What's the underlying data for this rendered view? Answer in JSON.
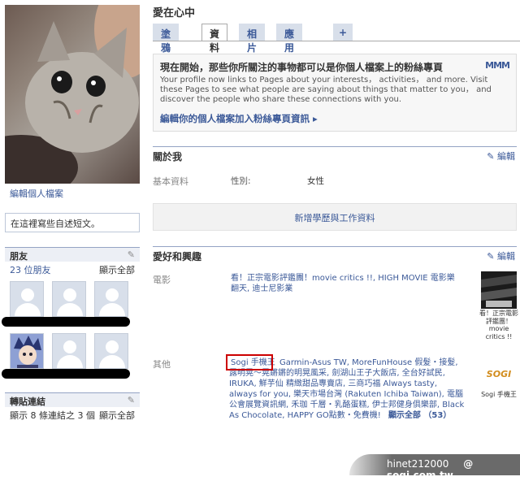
{
  "left": {
    "edit_profile": "編輯個人檔案",
    "status_placeholder": "在這裡寫些自述短文。",
    "friends": {
      "title": "朋友",
      "count": "23 位朋友",
      "show_all": "顯示全部"
    },
    "links": {
      "title": "轉貼連結",
      "summary": "顯示 8 條連結之 3 個",
      "show_all": "顯示全部"
    }
  },
  "header": {
    "name": "愛在心中",
    "tabs": [
      "塗鴉牆",
      "資料",
      "相片",
      "應用程式",
      "+"
    ]
  },
  "promo": {
    "title": "現在開始，那些你所關注的事物都可以是你個人檔案上的粉絲專頁",
    "text": "Your profile now links to Pages about your interests， activities， and more. Visit these Pages to see what people are saying about things that matter to you， and discover the people who share these connections with you.",
    "link": "編輯你的個人檔案加入粉絲專頁資訊 ▸",
    "icon": "MMM"
  },
  "about": {
    "title": "關於我",
    "edit": "編輯",
    "basic_label": "基本資料",
    "gender_label": "性別:",
    "gender_value": "女性",
    "add_edu": "新增學歷與工作資料"
  },
  "interests": {
    "title": "愛好和興趣",
    "edit": "編輯",
    "movies_label": "電影",
    "movies_text": "看！正宗電影評鑑團！movie critics !!, HIGH MOVIE 電影樂翻天, 迪士尼影業",
    "movies_thumb_caption": "看！正宗電影評鑑團！movie critics !!",
    "other_label": "其他",
    "other_first": "Sogi 手機王",
    "other_text": "Garmin-Asus TW, MoreFunHouse 假髮・接髮, 露明晃～晃鏘鏘的明晃風采, 劍湖山王子大飯店, 全台好試民, IRUKA, 鮮芋仙 精緻甜品專賣店, 三商巧福 Always tasty, always for you, 樂天市場台灣 (Rakuten Ichiba Taiwan), 電腦公會展覽資訊網, 禾珈 千層・乳酪蛋糕, 伊士邦健身俱樂部, Black As Chocolate, HAPPY GO點數・免費機!",
    "show_all": "顯示全部 （53）",
    "other_thumb_logo": "SOGI",
    "other_thumb_caption": "Sogi 手機王"
  },
  "watermark": {
    "user": "hinet212000",
    "site": "@ sogi.com.tw"
  }
}
